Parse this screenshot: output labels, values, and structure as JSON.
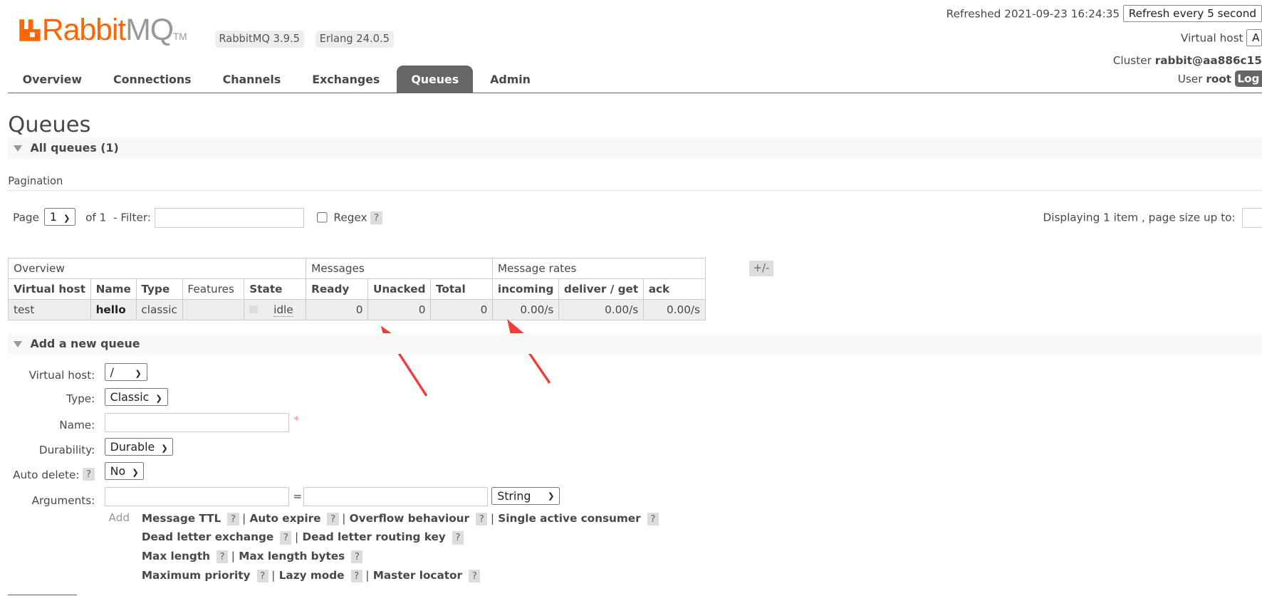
{
  "header": {
    "logo_rabbit": "Rabbit",
    "logo_mq": "MQ",
    "logo_tm": "TM",
    "version_badge": "RabbitMQ 3.9.5",
    "erlang_badge": "Erlang 24.0.5",
    "refreshed_label": "Refreshed 2021-09-23 16:24:35",
    "refresh_select": "Refresh every 5 second",
    "vhost_label": "Virtual host",
    "vhost_select": "A",
    "cluster_label": "Cluster",
    "cluster_name": "rabbit@aa886c15",
    "user_label": "User",
    "user_name": "root",
    "logout": "Log"
  },
  "nav": {
    "tabs": [
      "Overview",
      "Connections",
      "Channels",
      "Exchanges",
      "Queues",
      "Admin"
    ],
    "active": "Queues"
  },
  "page_title": "Queues",
  "all_queues": "All queues (1)",
  "pagination": {
    "heading": "Pagination",
    "page_label": "Page",
    "page_value": "1",
    "of_label": "of 1",
    "filter_label": "- Filter:",
    "regex_label": "Regex",
    "help": "?",
    "displaying": "Displaying 1 item , page size up to:"
  },
  "table": {
    "groups": [
      "Overview",
      "Messages",
      "Message rates"
    ],
    "plus_minus": "+/-",
    "columns": [
      "Virtual host",
      "Name",
      "Type",
      "Features",
      "State",
      "Ready",
      "Unacked",
      "Total",
      "incoming",
      "deliver / get",
      "ack"
    ],
    "rows": [
      {
        "vhost": "test",
        "name": "hello",
        "type": "classic",
        "features": "",
        "state": "idle",
        "ready": "0",
        "unacked": "0",
        "total": "0",
        "incoming": "0.00/s",
        "deliver_get": "0.00/s",
        "ack": "0.00/s"
      }
    ]
  },
  "add_queue": {
    "heading": "Add a new queue",
    "vhost_label": "Virtual host:",
    "vhost_value": "/",
    "type_label": "Type:",
    "type_value": "Classic",
    "name_label": "Name:",
    "required": "*",
    "durability_label": "Durability:",
    "durability_value": "Durable",
    "autodelete_label": "Auto delete:",
    "autodelete_value": "No",
    "arguments_label": "Arguments:",
    "equals": "=",
    "arg_type": "String",
    "add_label": "Add",
    "arg_rows": [
      [
        "Message TTL",
        "Auto expire",
        "Overflow behaviour",
        "Single active consumer"
      ],
      [
        "Dead letter exchange",
        "Dead letter routing key"
      ],
      [
        "Max length",
        "Max length bytes"
      ],
      [
        "Maximum priority",
        "Lazy mode",
        "Master locator"
      ]
    ]
  },
  "annotation_color": "#f03c3c"
}
